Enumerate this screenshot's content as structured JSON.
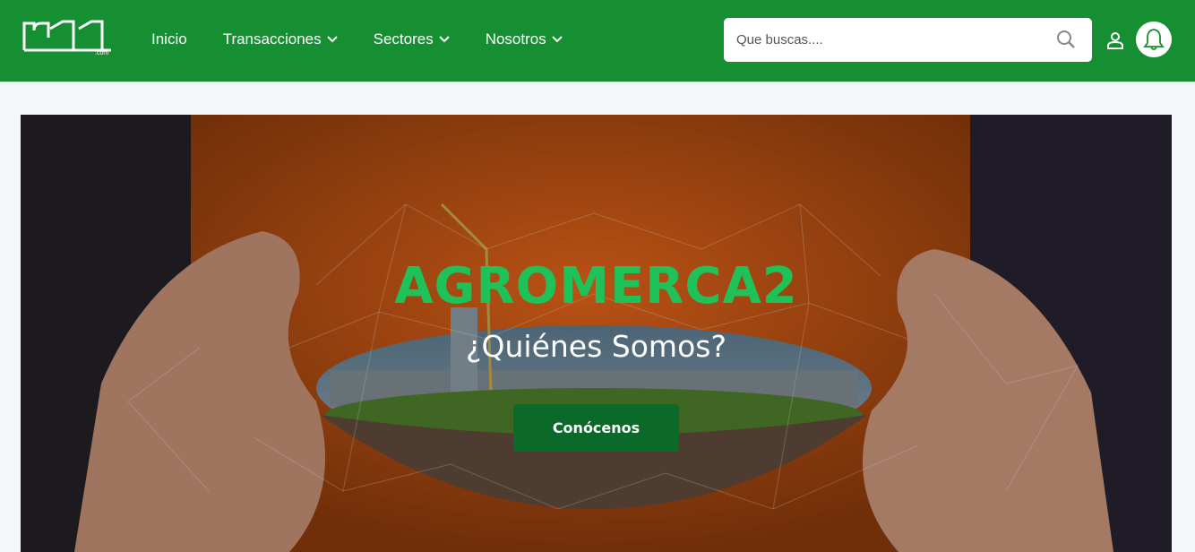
{
  "header": {
    "logo_text": "r1",
    "logo_suffix": ".com",
    "nav": [
      {
        "label": "Inicio",
        "has_dropdown": false
      },
      {
        "label": "Transacciones",
        "has_dropdown": true
      },
      {
        "label": "Sectores",
        "has_dropdown": true
      },
      {
        "label": "Nosotros",
        "has_dropdown": true
      }
    ],
    "search": {
      "placeholder": "Que buscas...."
    },
    "icons": {
      "search": "search-icon",
      "user": "user-icon",
      "notifications": "bell-icon",
      "dropdown": "chevron-down-icon"
    }
  },
  "hero": {
    "title": "AGROMERCA2",
    "subtitle": "¿Quiénes Somos?",
    "button_label": "Conócenos"
  },
  "colors": {
    "header_bg": "#158f32",
    "page_bg": "#f4f7fa",
    "hero_title": "#1fc259",
    "button_bg": "#0b6a2a"
  }
}
